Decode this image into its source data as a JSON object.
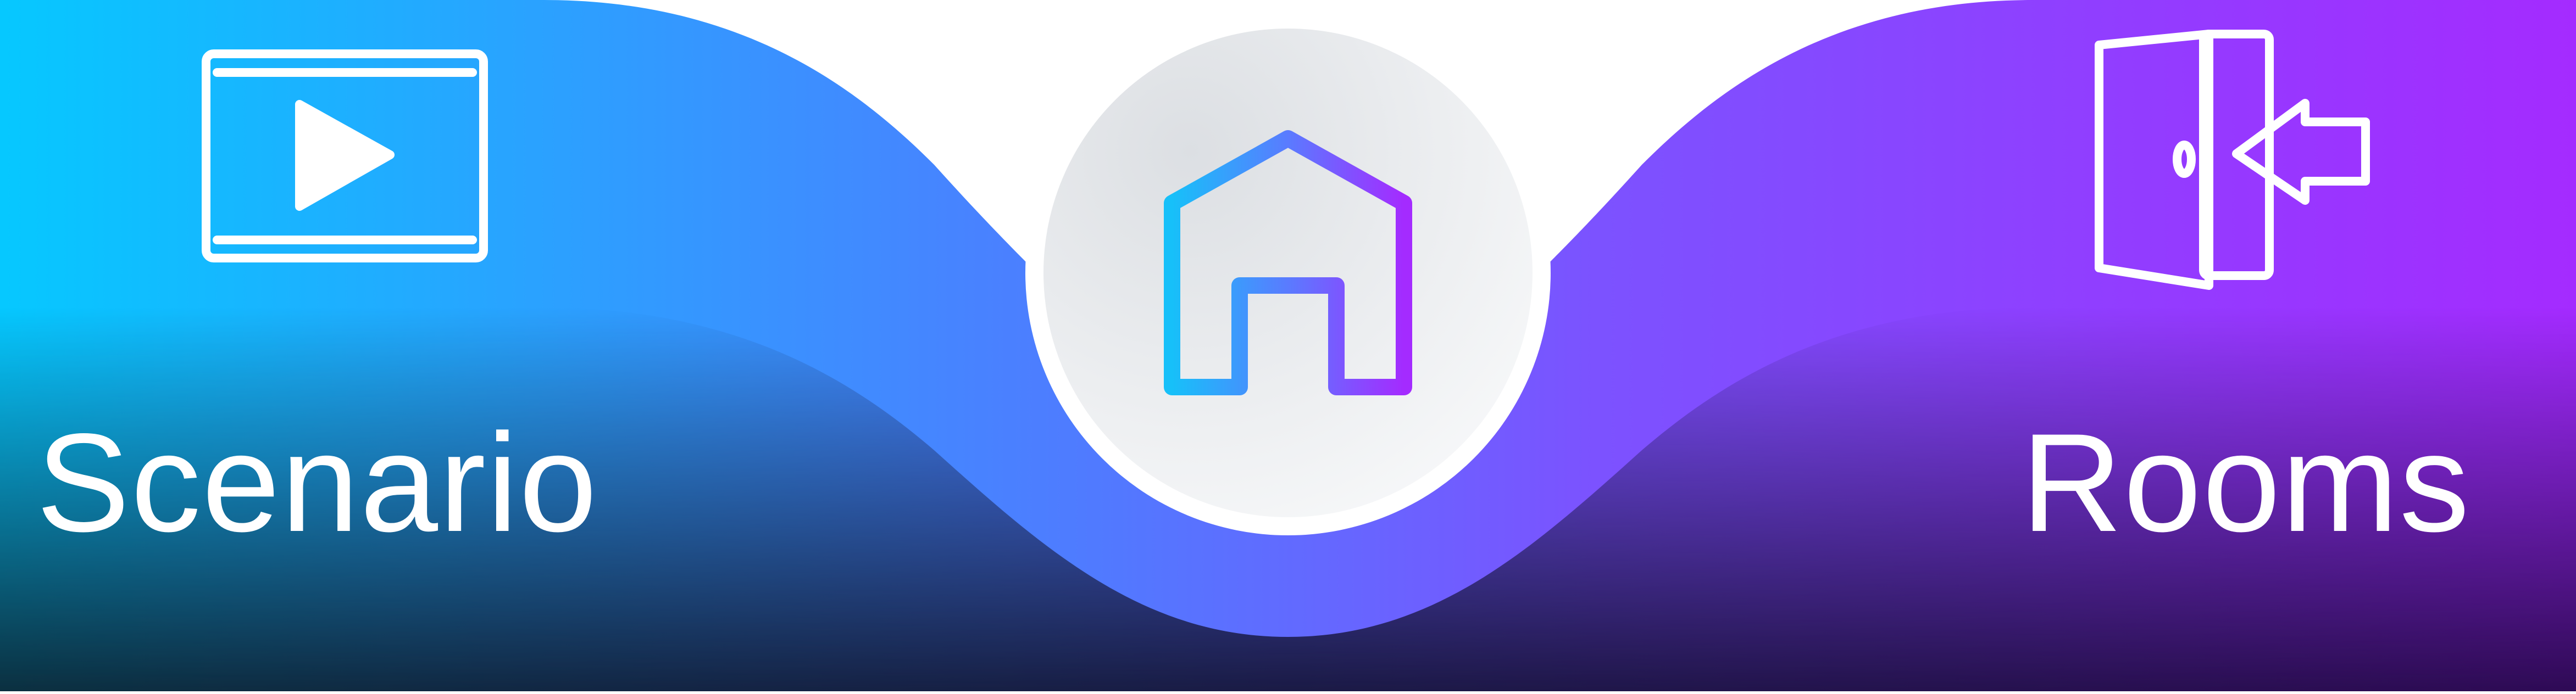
{
  "bottom_nav": {
    "scenario": {
      "label": "Scenario",
      "icon": "video-play-icon"
    },
    "home": {
      "icon": "home-icon"
    },
    "rooms": {
      "label": "Rooms",
      "icon": "door-enter-icon"
    }
  },
  "colors": {
    "gradient_start": "#06C8FF",
    "gradient_mid": "#4F7BFF",
    "gradient_end": "#A42BFF",
    "shade_left": "#0B2A3A",
    "shade_right": "#2A0A4A",
    "fab_background": "#E6E8EB",
    "icon_color": "#FFFFFF"
  }
}
